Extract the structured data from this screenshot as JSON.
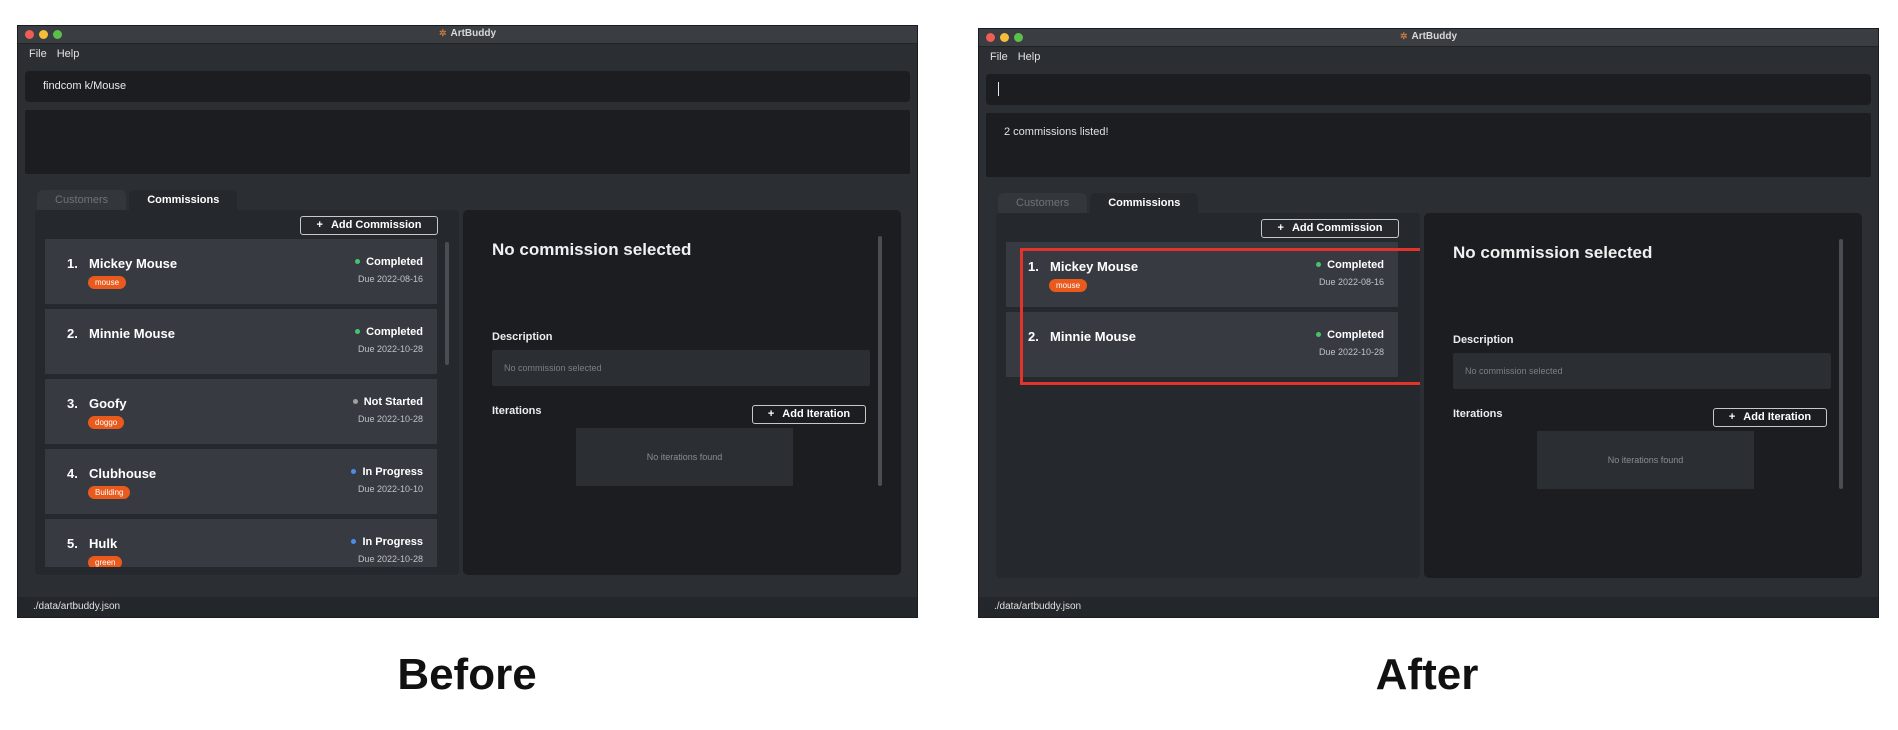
{
  "app": {
    "title": "ArtBuddy",
    "logo_icon": "palette-icon"
  },
  "menu": [
    "File",
    "Help"
  ],
  "tabs": {
    "customers": "Customers",
    "commissions": "Commissions"
  },
  "buttons": {
    "add_commission": "Add Commission",
    "add_iteration": "Add Iteration",
    "plus": "+"
  },
  "detail": {
    "title": "No commission selected",
    "description_label": "Description",
    "description_value": "No commission selected",
    "iterations_label": "Iterations",
    "iterations_empty": "No iterations found"
  },
  "footer": {
    "path": "./data/artbuddy.json"
  },
  "colors": {
    "accent_tag": "#ea5a1c",
    "completed": "#46c46c",
    "not_started": "#a0a0a0",
    "in_progress": "#4a8eea",
    "highlight": "#e3342b"
  },
  "before": {
    "caption": "Before",
    "command": "findcom k/Mouse",
    "result": "",
    "commissions": [
      {
        "index": "1.",
        "name": "Mickey Mouse",
        "tag": "mouse",
        "status": "Completed",
        "due": "Due 2022-08-16"
      },
      {
        "index": "2.",
        "name": "Minnie Mouse",
        "tag": "",
        "status": "Completed",
        "due": "Due 2022-10-28"
      },
      {
        "index": "3.",
        "name": "Goofy",
        "tag": "doggo",
        "status": "Not Started",
        "due": "Due 2022-10-28"
      },
      {
        "index": "4.",
        "name": "Clubhouse",
        "tag": "Building",
        "status": "In Progress",
        "due": "Due 2022-10-10"
      },
      {
        "index": "5.",
        "name": "Hulk",
        "tag": "green",
        "status": "In Progress",
        "due": "Due 2022-10-28"
      }
    ]
  },
  "after": {
    "caption": "After",
    "command": "",
    "result": "2 commissions listed!",
    "commissions": [
      {
        "index": "1.",
        "name": "Mickey Mouse",
        "tag": "mouse",
        "status": "Completed",
        "due": "Due 2022-08-16"
      },
      {
        "index": "2.",
        "name": "Minnie Mouse",
        "tag": "",
        "status": "Completed",
        "due": "Due 2022-10-28"
      }
    ]
  }
}
